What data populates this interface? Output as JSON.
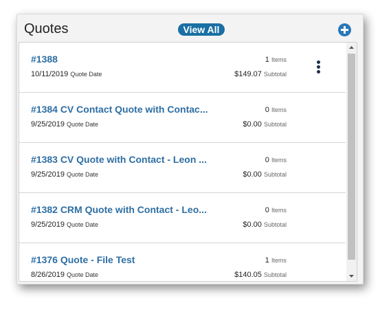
{
  "widget": {
    "title": "Quotes",
    "view_all_label": "View All",
    "add_icon": "plus-circle-icon",
    "menu_icon": "more-vertical-icon"
  },
  "quotes": [
    {
      "title": "#1388",
      "date": "10/11/2019",
      "date_label": "Quote Date",
      "items": "1",
      "items_label": "Items",
      "subtotal": "$149.07",
      "subtotal_label": "Subtotal"
    },
    {
      "title": "#1384 CV Contact Quote with Contac...",
      "date": "9/25/2019",
      "date_label": "Quote Date",
      "items": "0",
      "items_label": "Items",
      "subtotal": "$0.00",
      "subtotal_label": "Subtotal"
    },
    {
      "title": "#1383 CV Quote with Contact - Leon ...",
      "date": "9/25/2019",
      "date_label": "Quote Date",
      "items": "0",
      "items_label": "Items",
      "subtotal": "$0.00",
      "subtotal_label": "Subtotal"
    },
    {
      "title": "#1382 CRM Quote with Contact - Leo...",
      "date": "9/25/2019",
      "date_label": "Quote Date",
      "items": "0",
      "items_label": "Items",
      "subtotal": "$0.00",
      "subtotal_label": "Subtotal"
    },
    {
      "title": "#1376 Quote - File Test",
      "date": "8/26/2019",
      "date_label": "Quote Date",
      "items": "1",
      "items_label": "Items",
      "subtotal": "$140.05",
      "subtotal_label": "Subtotal"
    }
  ],
  "colors": {
    "accent": "#1a6fa3",
    "link": "#2d6ea3",
    "kebab": "#1e2f4a"
  }
}
